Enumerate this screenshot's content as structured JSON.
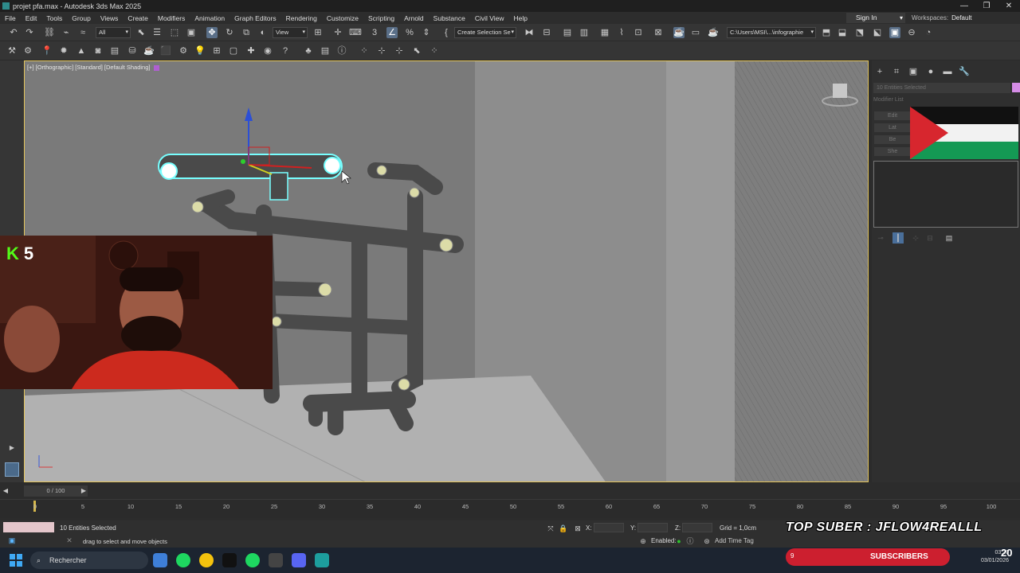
{
  "window": {
    "title": "projet pfa.max - Autodesk 3ds Max 2025",
    "controls": [
      "—",
      "❐",
      "✕"
    ]
  },
  "menu": {
    "items": [
      "File",
      "Edit",
      "Tools",
      "Group",
      "Views",
      "Create",
      "Modifiers",
      "Animation",
      "Graph Editors",
      "Rendering",
      "Customize",
      "Scripting",
      "Arnold",
      "Substance",
      "Civil View",
      "Help"
    ],
    "sign_in": "Sign In",
    "workspaces_label": "Workspaces:",
    "workspaces_value": "Default"
  },
  "toolbar": {
    "selection_filter": "All",
    "ref_coord": "View",
    "selection_set": "Create Selection Se",
    "project_path": "C:\\Users\\MSI\\...\\infographie"
  },
  "viewport": {
    "label": "[+] [Orthographic] [Standard] [Default Shading]"
  },
  "command_panel": {
    "selection_name": "10 Entities Selected",
    "modifier_list": "Modifier List",
    "modifier_buttons": [
      "Edit",
      "Lat",
      "Be",
      "She"
    ]
  },
  "timeline": {
    "slider_label": "0 / 100",
    "ticks": [
      "0",
      "5",
      "10",
      "15",
      "20",
      "25",
      "30",
      "35",
      "40",
      "45",
      "50",
      "55",
      "60",
      "65",
      "70",
      "75",
      "80",
      "85",
      "90",
      "95",
      "100"
    ]
  },
  "status": {
    "selection": "10 Entities Selected",
    "prompt": "drag to select and move objects",
    "x_label": "X:",
    "y_label": "Y:",
    "z_label": "Z:",
    "grid": "Grid = 1,0cm",
    "enabled": "Enabled:",
    "add_time_tag": "Add Time Tag"
  },
  "overlay": {
    "kick_count": "5",
    "top_suber": "TOP SUBER : JFLOW4REALLL",
    "subscribers_count": "9",
    "subscribers_label": "SUBSCRIBERS"
  },
  "taskbar": {
    "search_placeholder": "Rechercher",
    "time": "03:20",
    "date": "03/01/2026",
    "clock_big": "20"
  }
}
